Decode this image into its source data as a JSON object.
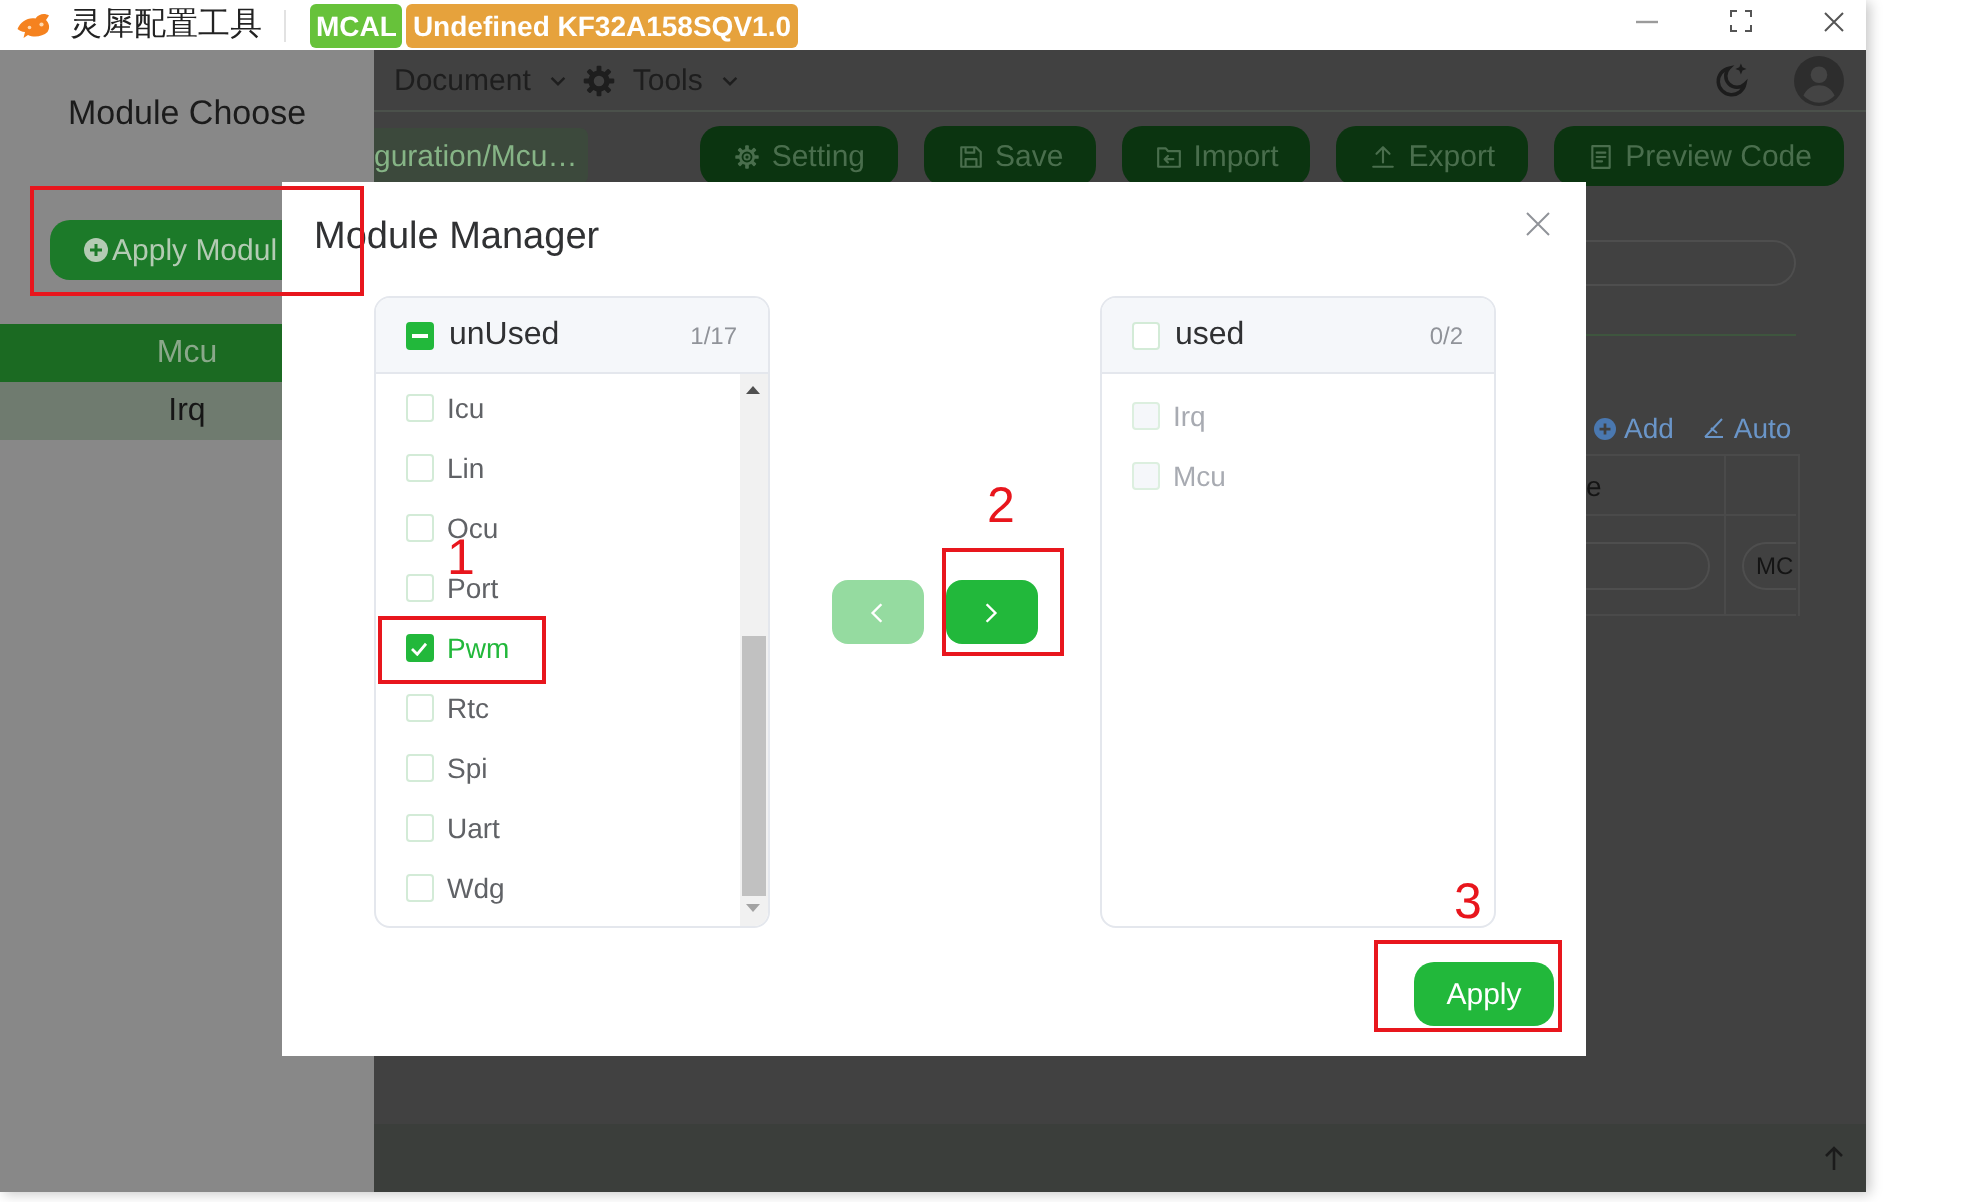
{
  "title_bar": {
    "app_name": "灵犀配置工具",
    "badges": [
      {
        "text": "MCAL",
        "color": "#67c23a"
      },
      {
        "text": "Undefined KF32A158SQV1.0",
        "color": "#e6a23c"
      }
    ]
  },
  "menu_bar": {
    "menus": [
      {
        "label": "Document",
        "kind": "plain"
      },
      {
        "label": "Tools",
        "kind": "with-icon"
      }
    ]
  },
  "toolbar": {
    "breadcrumb": "guration/Mcu…",
    "buttons": [
      {
        "label": "Setting",
        "kind": "setting"
      },
      {
        "label": "Save",
        "kind": "save"
      },
      {
        "label": "Import",
        "kind": "import"
      },
      {
        "label": "Export",
        "kind": "export"
      },
      {
        "label": "Preview Code",
        "kind": "preview"
      }
    ]
  },
  "drawer": {
    "title": "Module Choose",
    "apply_button": {
      "label": "Apply Modul",
      "marked": true
    },
    "modules": [
      {
        "label": "Mcu",
        "selected": true
      },
      {
        "label": "Irq",
        "selected": false
      }
    ]
  },
  "content": {
    "actions": [
      {
        "label": "Add",
        "kind": "add"
      },
      {
        "label": "Auto",
        "kind": "auto"
      }
    ],
    "table": {
      "column_1": "e",
      "rows": [
        {
          "column_2": "MC"
        }
      ]
    }
  },
  "modal": {
    "title": "Module Manager",
    "source": {
      "title": "unUsed",
      "count": "1/17",
      "indeterminate": true,
      "items": [
        {
          "label": "Icu",
          "checked": false,
          "disabled": false,
          "marked": false
        },
        {
          "label": "Lin",
          "checked": false,
          "disabled": false,
          "marked": false
        },
        {
          "label": "Ocu",
          "checked": false,
          "disabled": false,
          "marked": false
        },
        {
          "label": "Port",
          "checked": false,
          "disabled": false,
          "marked": false
        },
        {
          "label": "Pwm",
          "checked": true,
          "disabled": false,
          "marked": true,
          "step": "1"
        },
        {
          "label": "Rtc",
          "checked": false,
          "disabled": false,
          "marked": false
        },
        {
          "label": "Spi",
          "checked": false,
          "disabled": false,
          "marked": false
        },
        {
          "label": "Uart",
          "checked": false,
          "disabled": false,
          "marked": false
        },
        {
          "label": "Wdg",
          "checked": false,
          "disabled": false,
          "marked": false
        }
      ]
    },
    "target": {
      "title": "used",
      "count": "0/2",
      "indeterminate": false,
      "items": [
        {
          "label": "Irq",
          "checked": false,
          "disabled": true,
          "marked": false
        },
        {
          "label": "Mcu",
          "checked": false,
          "disabled": true,
          "marked": false
        }
      ]
    },
    "move_buttons": [
      {
        "kind": "left",
        "disabled": true,
        "marked": false
      },
      {
        "kind": "right",
        "disabled": false,
        "marked": true,
        "step": "2"
      }
    ],
    "apply_button": {
      "label": "Apply",
      "marked": true,
      "step": "3"
    }
  }
}
